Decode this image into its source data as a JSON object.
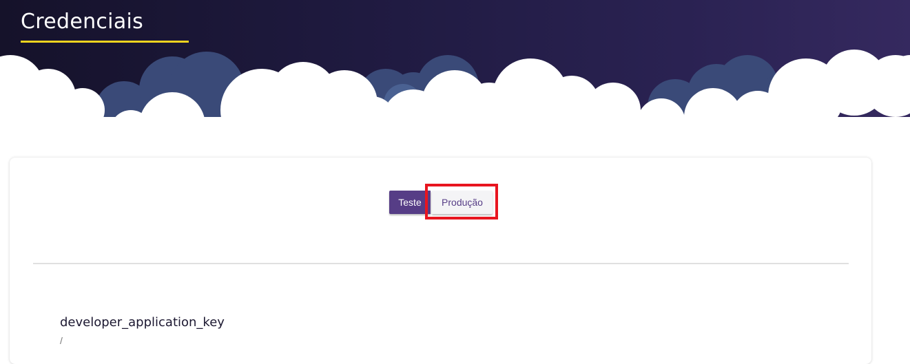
{
  "header": {
    "title": "Credenciais"
  },
  "colors": {
    "header_gradient_start": "#15122a",
    "header_gradient_end": "#35295f",
    "title_underline": "#f2d41f",
    "primary": "#563d86",
    "highlight": "#e8151f"
  },
  "environment_toggle": {
    "test_label": "Teste",
    "production_label": "Produção",
    "selected": "Teste"
  },
  "credentials": {
    "field_label": "developer_application_key",
    "field_value": "/"
  }
}
